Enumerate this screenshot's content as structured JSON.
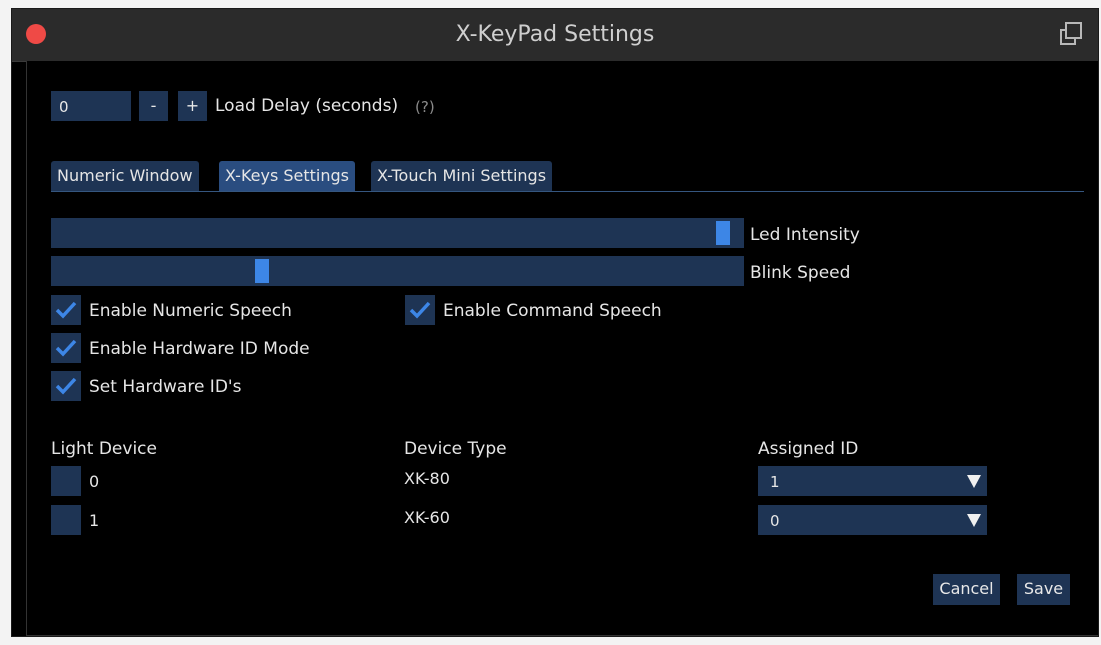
{
  "window": {
    "title": "X-KeyPad Settings"
  },
  "load_delay": {
    "value": "0",
    "minus_label": "-",
    "plus_label": "+",
    "label": "Load Delay (seconds)",
    "help": "(?)"
  },
  "tabs": [
    {
      "label": "Numeric Window",
      "active": false
    },
    {
      "label": "X-Keys Settings",
      "active": true
    },
    {
      "label": "X-Touch Mini Settings",
      "active": false
    }
  ],
  "sliders": {
    "led_intensity": {
      "label": "Led Intensity",
      "value": 0.98
    },
    "blink_speed": {
      "label": "Blink Speed",
      "value": 0.3
    }
  },
  "checkboxes": {
    "numeric_speech": {
      "label": "Enable Numeric Speech",
      "checked": true
    },
    "command_speech": {
      "label": "Enable Command Speech",
      "checked": true
    },
    "hardware_id_mode": {
      "label": "Enable Hardware ID Mode",
      "checked": true
    },
    "set_hardware_ids": {
      "label": "Set Hardware ID's",
      "checked": true
    }
  },
  "devices": {
    "headers": {
      "light": "Light Device",
      "type": "Device Type",
      "assigned": "Assigned ID"
    },
    "rows": [
      {
        "index": "0",
        "type": "XK-80",
        "assigned_id": "1"
      },
      {
        "index": "1",
        "type": "XK-60",
        "assigned_id": "0"
      }
    ]
  },
  "footer": {
    "cancel_label": "Cancel",
    "save_label": "Save"
  },
  "colors": {
    "accent": "#3d86e6",
    "control_bg": "#1e3454",
    "close_button": "#ef4a46"
  }
}
